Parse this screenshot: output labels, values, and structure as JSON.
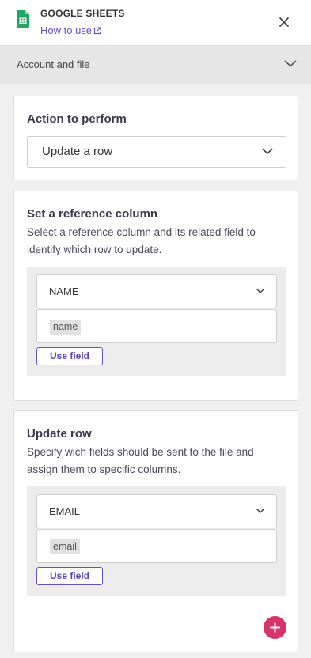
{
  "header": {
    "app_title": "GOOGLE SHEETS",
    "how_to_use": "How to use"
  },
  "section": {
    "label": "Account and file"
  },
  "action_card": {
    "title": "Action to perform",
    "selected_action": "Update a row"
  },
  "reference_card": {
    "title": "Set a reference column",
    "description": "Select a reference column and its related field to identify which row to update.",
    "column": "NAME",
    "field_tag": "name",
    "use_field_label": "Use field"
  },
  "update_card": {
    "title": "Update row",
    "description": "Specify wich fields should be sent to the file and assign them to specific columns.",
    "column": "EMAIL",
    "field_tag": "email",
    "use_field_label": "Use field"
  },
  "colors": {
    "accent": "#6a4fc1",
    "add_button": "#d6336c",
    "sheets_green": "#23a566"
  },
  "icons": [
    "google-sheets-icon",
    "external-link-icon",
    "close-icon",
    "chevron-down-icon",
    "plus-icon"
  ]
}
